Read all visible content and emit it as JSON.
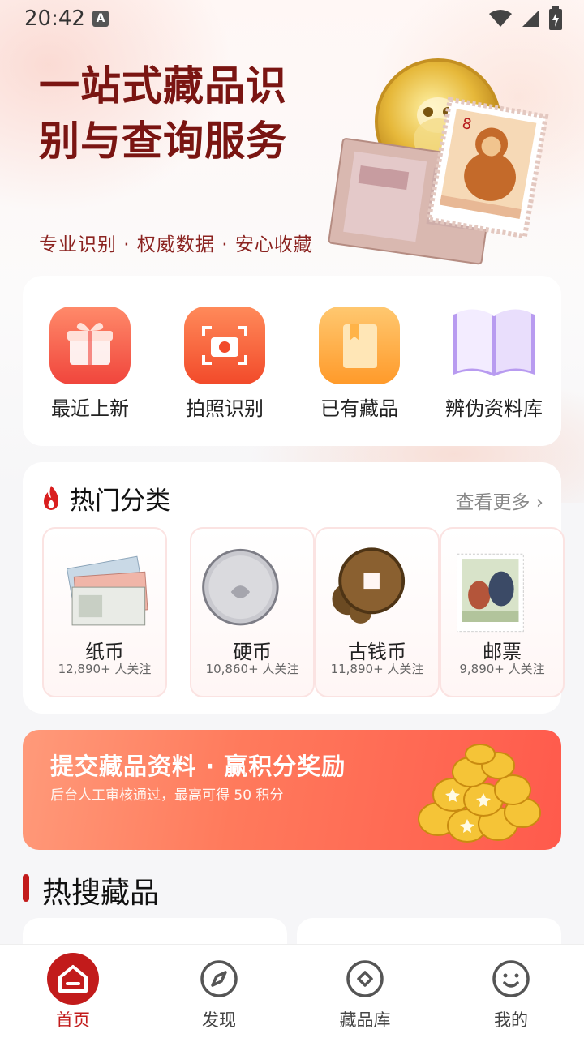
{
  "status_bar": {
    "time": "20:42",
    "notification_letter": "A"
  },
  "hero": {
    "title": "一站式藏品识别与查询服务",
    "subtitle": "专业识别 · 权威数据 · 安心收藏"
  },
  "quick_actions": [
    {
      "label": "最近上新",
      "icon": "gift-icon"
    },
    {
      "label": "拍照识别",
      "icon": "camera-icon"
    },
    {
      "label": "已有藏品",
      "icon": "bookmark-book-icon"
    },
    {
      "label": "辨伪资料库",
      "icon": "open-book-icon"
    }
  ],
  "hot_categories": {
    "title": "热门分类",
    "more": "查看更多",
    "items": [
      {
        "name": "纸币",
        "followers": "12,890+ 人关注"
      },
      {
        "name": "硬币",
        "followers": "10,860+ 人关注"
      },
      {
        "name": "古钱币",
        "followers": "11,890+ 人关注"
      },
      {
        "name": "邮票",
        "followers": "9,890+ 人关注"
      }
    ]
  },
  "banner": {
    "title": "提交藏品资料 · 赢积分奖励",
    "subtitle": "后台人工审核通过，最高可得 50 积分"
  },
  "hot_search": {
    "title": "热搜藏品"
  },
  "bottom_nav": [
    {
      "label": "首页",
      "icon": "home-icon",
      "active": true
    },
    {
      "label": "发现",
      "icon": "compass-icon",
      "active": false
    },
    {
      "label": "藏品库",
      "icon": "diamond-icon",
      "active": false
    },
    {
      "label": "我的",
      "icon": "smile-icon",
      "active": false
    }
  ],
  "colors": {
    "brand_red": "#c21b1b",
    "hero_title": "#7a1512",
    "banner_start": "#ff9a7a",
    "banner_end": "#ff5a4c"
  }
}
